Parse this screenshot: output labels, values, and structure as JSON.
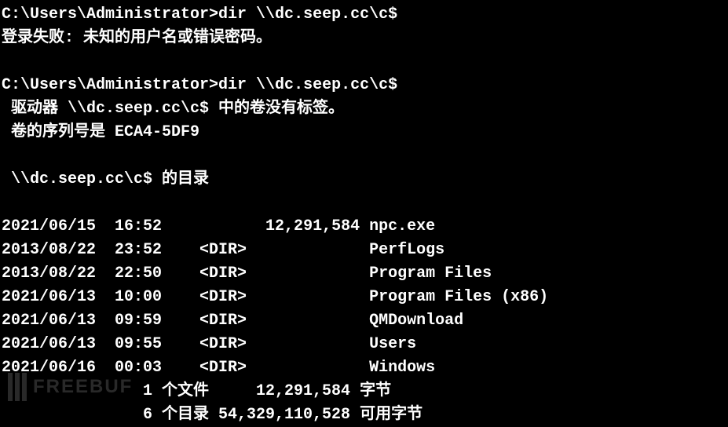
{
  "cmd1": {
    "prompt": "C:\\Users\\Administrator>",
    "command": "dir \\\\dc.seep.cc\\c$",
    "error": "登录失败: 未知的用户名或错误密码。"
  },
  "cmd2": {
    "prompt": "C:\\Users\\Administrator>",
    "command": "dir \\\\dc.seep.cc\\c$",
    "volume_line": " 驱动器 \\\\dc.seep.cc\\c$ 中的卷没有标签。",
    "serial_line": " 卷的序列号是 ECA4-5DF9",
    "directory_of": " \\\\dc.seep.cc\\c$ 的目录"
  },
  "listing": [
    {
      "date": "2021/06/15",
      "time": "16:52",
      "type": "          ",
      "size": "12,291,584",
      "name": "npc.exe"
    },
    {
      "date": "2013/08/22",
      "time": "23:52",
      "type": "   <DIR>  ",
      "size": "        ",
      "name": "PerfLogs"
    },
    {
      "date": "2013/08/22",
      "time": "22:50",
      "type": "   <DIR>  ",
      "size": "        ",
      "name": "Program Files"
    },
    {
      "date": "2021/06/13",
      "time": "10:00",
      "type": "   <DIR>  ",
      "size": "        ",
      "name": "Program Files (x86)"
    },
    {
      "date": "2021/06/13",
      "time": "09:59",
      "type": "   <DIR>  ",
      "size": "        ",
      "name": "QMDownload"
    },
    {
      "date": "2021/06/13",
      "time": "09:55",
      "type": "   <DIR>  ",
      "size": "        ",
      "name": "Users"
    },
    {
      "date": "2021/06/16",
      "time": "00:03",
      "type": "   <DIR>  ",
      "size": "        ",
      "name": "Windows"
    }
  ],
  "summary": {
    "files_line": "               1 个文件     12,291,584 字节",
    "dirs_line": "               6 个目录 54,329,110,528 可用字节"
  },
  "watermark": "FREEBUF"
}
